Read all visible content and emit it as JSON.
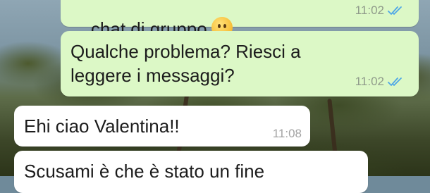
{
  "messages": [
    {
      "direction": "outgoing",
      "text": "chat di gruppo",
      "emoji": "slightly-frowning-face-emoji",
      "time": "11:02",
      "status": "read-double-check"
    },
    {
      "direction": "outgoing",
      "line1": "Qualche problema? Riesci a",
      "line2": "leggere i messaggi?",
      "time": "11:02",
      "status": "read-double-check"
    },
    {
      "direction": "incoming",
      "text": "Ehi ciao Valentina!!",
      "time": "11:08"
    },
    {
      "direction": "incoming",
      "text": "Scusami è che è stato un fine"
    }
  ],
  "colors": {
    "outgoing_bubble": "#dcf8c6",
    "incoming_bubble": "#ffffff",
    "read_ticks": "#4fa7e6"
  }
}
